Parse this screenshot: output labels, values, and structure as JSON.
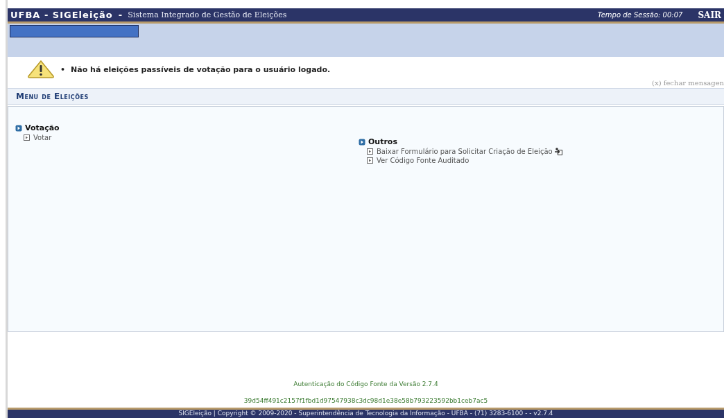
{
  "header": {
    "system": "UFBA - SIGEleição",
    "separator": "-",
    "subtitle": "Sistema Integrado de Gestão de Eleições",
    "session": "Tempo de Sessão: 00:07",
    "logout": "SAIR"
  },
  "message": {
    "bullet": "•",
    "text": "Não há eleições passíveis de votação para o usuário logado.",
    "close": "(x) fechar mensagen"
  },
  "menu": {
    "title": "Menu de Eleições",
    "groups": [
      {
        "title": "Votação",
        "items": [
          {
            "label": "Votar",
            "external": false
          }
        ]
      },
      {
        "title": "Outros",
        "items": [
          {
            "label": "Baixar Formulário para Solicitar Criação de Eleição",
            "external": true
          },
          {
            "label": "Ver Código Fonte Auditado",
            "external": false
          }
        ]
      }
    ]
  },
  "footer": {
    "auth": "Autenticação do Código Fonte da Versão 2.7.4",
    "hash": "39d54ff491c2157f1fbd1d97547938c3dc98d1e38e58b793223592bb1ceb7ac5",
    "copyright": "SIGEleição | Copyright © 2009-2020 - Superintendência de Tecnologia da Informação - UFBA - (71) 3283-6100 - - v2.7.4"
  }
}
